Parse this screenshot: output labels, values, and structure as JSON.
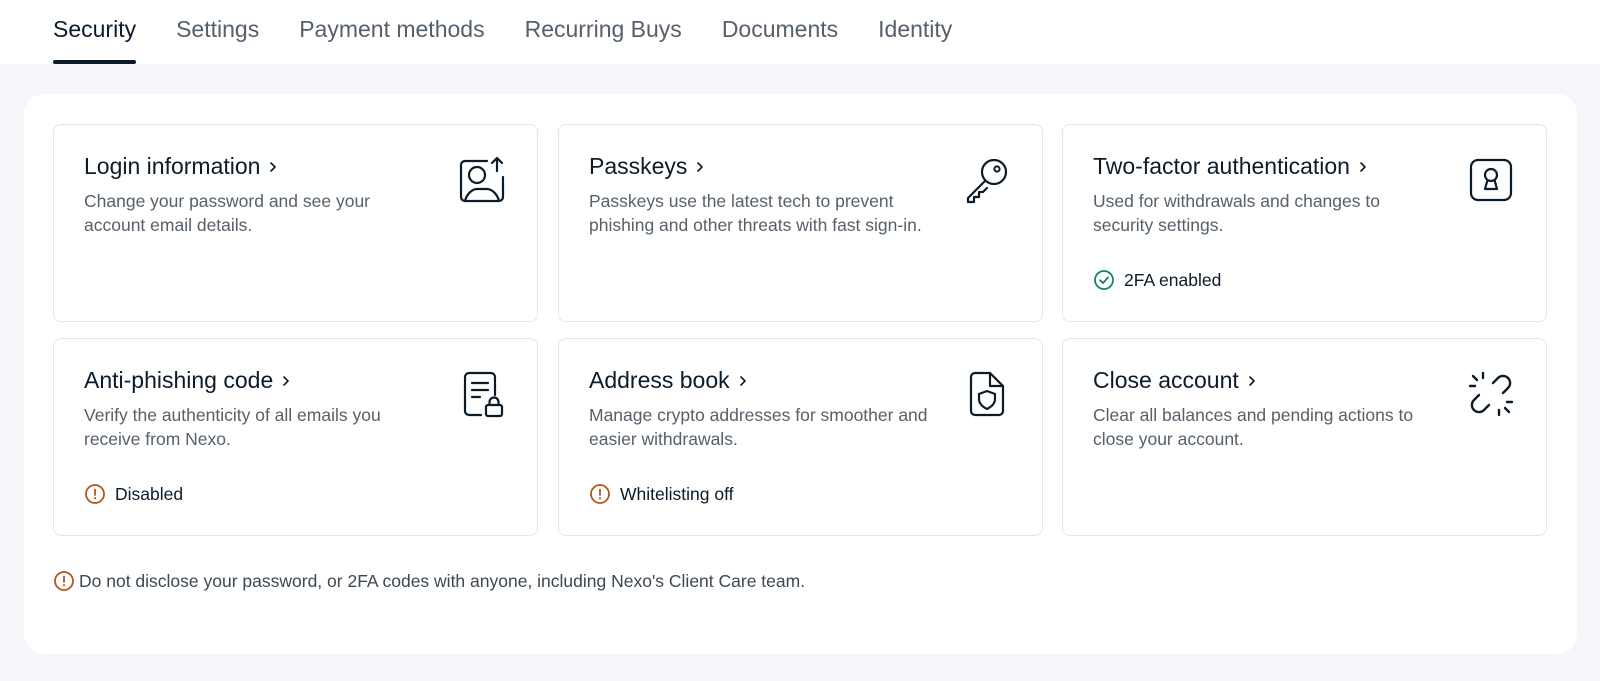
{
  "tabs": [
    {
      "label": "Security",
      "active": true
    },
    {
      "label": "Settings"
    },
    {
      "label": "Payment methods"
    },
    {
      "label": "Recurring Buys"
    },
    {
      "label": "Documents"
    },
    {
      "label": "Identity"
    }
  ],
  "cards": {
    "login": {
      "title": "Login information",
      "description": "Change your password and see your account email details.",
      "icon": "user-upload-icon"
    },
    "passkeys": {
      "title": "Passkeys",
      "description": "Passkeys use the latest tech to prevent phishing and other threats with fast sign-in.",
      "icon": "key-icon"
    },
    "twofa": {
      "title": "Two-factor authentication",
      "description": "Used for withdrawals and changes to security settings.",
      "icon": "keyhole-icon",
      "status": "2FA enabled",
      "status_type": "ok"
    },
    "antiphishing": {
      "title": "Anti-phishing code",
      "description": "Verify the authenticity of all emails you receive from Nexo.",
      "icon": "document-lock-icon",
      "status": "Disabled",
      "status_type": "warning"
    },
    "addressbook": {
      "title": "Address book",
      "description": "Manage crypto addresses for smoother and easier withdrawals.",
      "icon": "file-shield-icon",
      "status": "Whitelisting off",
      "status_type": "warning"
    },
    "close": {
      "title": "Close account",
      "description": "Clear all balances and pending actions to close your account.",
      "icon": "broken-link-icon"
    }
  },
  "warning": "Do not disclose your password, or 2FA codes with anyone, including Nexo's Client Care team.",
  "colors": {
    "ok": "#1f7a6e",
    "warning": "#b5561c",
    "text": "#0c1b2a"
  }
}
